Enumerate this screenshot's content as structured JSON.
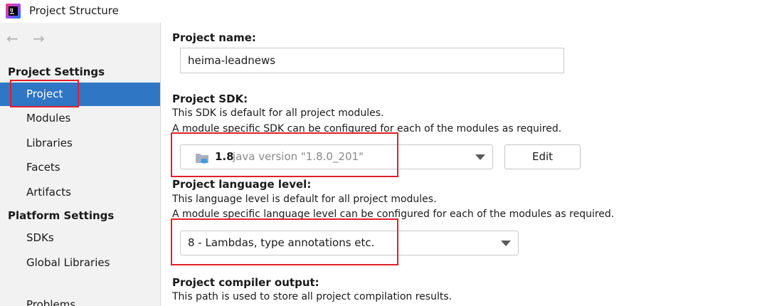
{
  "window": {
    "title": "Project Structure"
  },
  "nav": {
    "back_glyph": "←",
    "forward_glyph": "→"
  },
  "sidebar": {
    "sections": [
      {
        "header": "Project Settings",
        "items": [
          "Project",
          "Modules",
          "Libraries",
          "Facets",
          "Artifacts"
        ]
      },
      {
        "header": "Platform Settings",
        "items": [
          "SDKs",
          "Global Libraries"
        ]
      }
    ],
    "partial_item": "Problems",
    "selected": "Project"
  },
  "main": {
    "project_name": {
      "label": "Project name:",
      "value": "heima-leadnews"
    },
    "project_sdk": {
      "label": "Project SDK:",
      "desc1": "This SDK is default for all project modules.",
      "desc2": "A module specific SDK can be configured for each of the modules as required.",
      "version": "1.8",
      "detail": "java version \"1.8.0_201\"",
      "edit_label": "Edit"
    },
    "language_level": {
      "label": "Project language level:",
      "desc1": "This language level is default for all project modules.",
      "desc2": "A module specific language level can be configured for each of the modules as required.",
      "value": "8 - Lambdas, type annotations etc."
    },
    "compiler_output": {
      "label": "Project compiler output:",
      "desc1": "This path is used to store all project compilation results."
    }
  },
  "colors": {
    "selection": "#2f76c4",
    "highlight": "#e0202a",
    "sidebar_bg": "#f2f2f2"
  },
  "icons": [
    "intellij-app-icon",
    "back-arrow-icon",
    "forward-arrow-icon",
    "folder-sdk-icon",
    "chevron-down-icon"
  ]
}
